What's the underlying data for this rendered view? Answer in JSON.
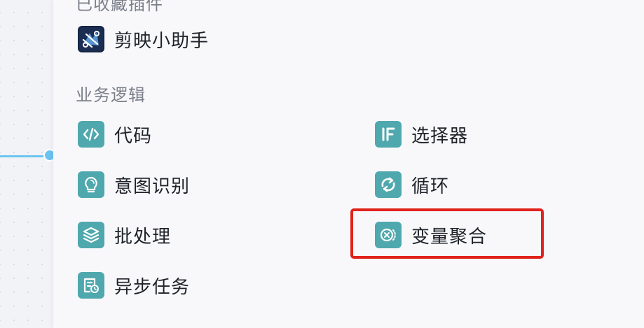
{
  "panel": {
    "collected_title": "已收藏插件",
    "plugins": [
      {
        "label": "剪映小助手",
        "icon": "jianying-plugin-icon"
      }
    ],
    "logic_title": "业务逻辑",
    "logic_items": [
      {
        "label": "代码",
        "icon": "code-icon"
      },
      {
        "label": "选择器",
        "icon": "if-selector-icon"
      },
      {
        "label": "意图识别",
        "icon": "lightbulb-icon"
      },
      {
        "label": "循环",
        "icon": "loop-icon"
      },
      {
        "label": "批处理",
        "icon": "layers-icon"
      },
      {
        "label": "变量聚合",
        "icon": "variable-aggregate-icon"
      },
      {
        "label": "异步任务",
        "icon": "async-task-icon"
      }
    ]
  },
  "colors": {
    "icon_bg": "#4fa8ad",
    "highlight": "#e0231c",
    "edge": "#6bc4f0"
  }
}
